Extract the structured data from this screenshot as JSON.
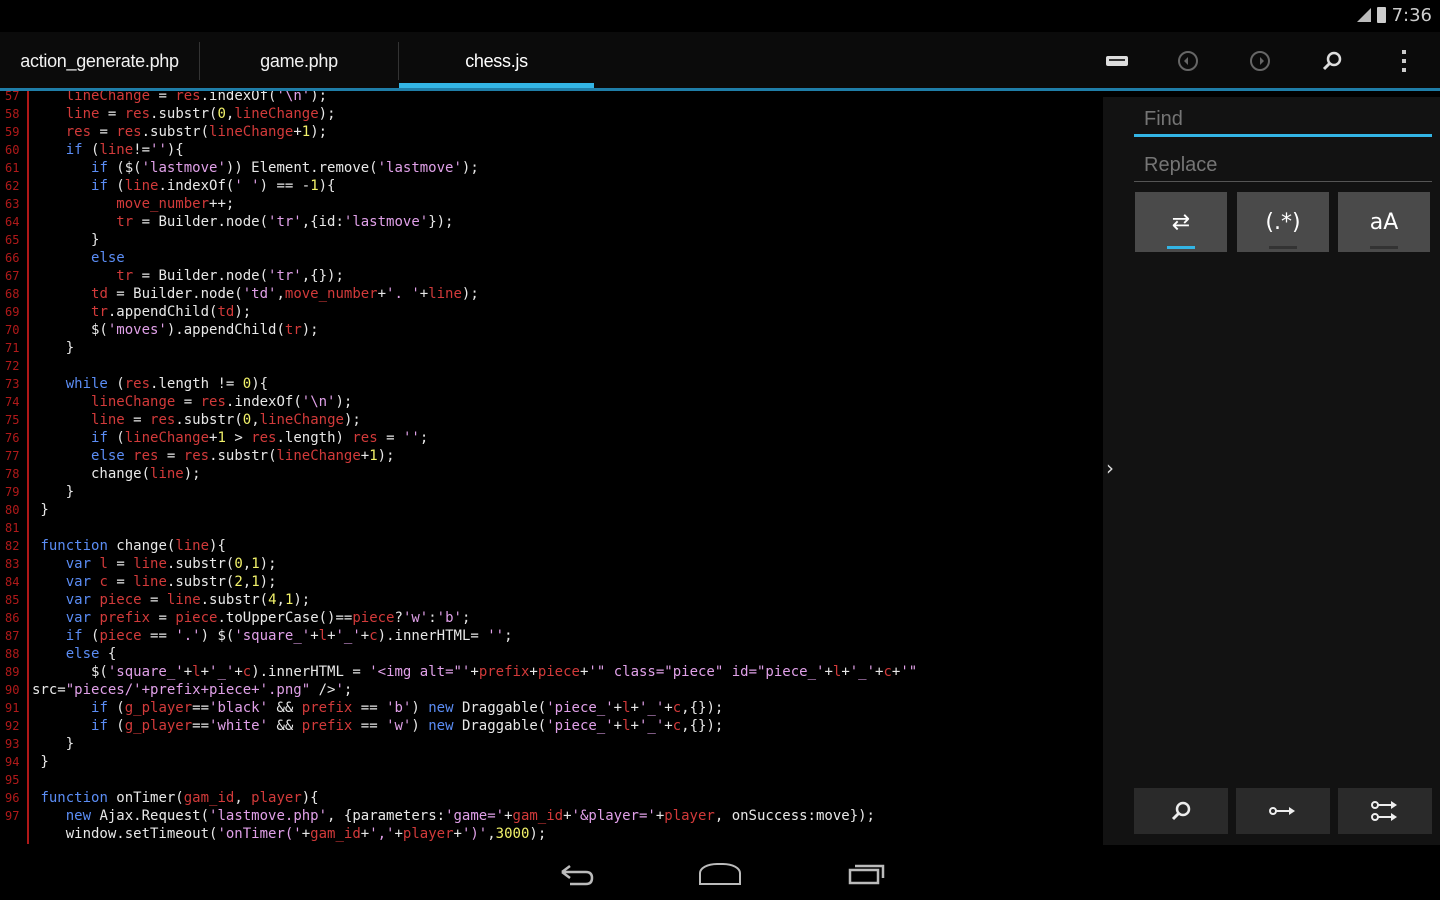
{
  "status_bar": {
    "time": "7:36",
    "icons": [
      "signal-icon",
      "battery-icon"
    ]
  },
  "tabs": [
    {
      "label": "action_generate.php",
      "active": false
    },
    {
      "label": "game.php",
      "active": false
    },
    {
      "label": "chess.js",
      "active": true
    }
  ],
  "action_icons": [
    "keyboard-icon",
    "undo-icon",
    "redo-icon",
    "search-icon",
    "overflow-menu-icon"
  ],
  "colors": {
    "accent": "#33b5e5",
    "line_number": "#b01a1a",
    "keyword": "#5b8df5",
    "string": "#e0a0e8",
    "number": "#f2f26a",
    "variable": "#d23a3a",
    "text": "#e8e8e8"
  },
  "code_lines": [
    {
      "n": "57",
      "text": "    lineChange = res.indexOf('\\n');"
    },
    {
      "n": "58",
      "text": "    line = res.substr(0,lineChange);"
    },
    {
      "n": "59",
      "text": "    res = res.substr(lineChange+1);"
    },
    {
      "n": "60",
      "text": "    if (line!=''){"
    },
    {
      "n": "61",
      "text": "       if ($('lastmove')) Element.remove('lastmove');"
    },
    {
      "n": "62",
      "text": "       if (line.indexOf(' ') == -1){"
    },
    {
      "n": "63",
      "text": "          move_number++;"
    },
    {
      "n": "64",
      "text": "          tr = Builder.node('tr',{id:'lastmove'});"
    },
    {
      "n": "65",
      "text": "       }"
    },
    {
      "n": "66",
      "text": "       else"
    },
    {
      "n": "67",
      "text": "          tr = Builder.node('tr',{});"
    },
    {
      "n": "68",
      "text": "       td = Builder.node('td',move_number+'. '+line);"
    },
    {
      "n": "69",
      "text": "       tr.appendChild(td);"
    },
    {
      "n": "70",
      "text": "       $('moves').appendChild(tr);"
    },
    {
      "n": "71",
      "text": "    }"
    },
    {
      "n": "72",
      "text": ""
    },
    {
      "n": "73",
      "text": "    while (res.length != 0){"
    },
    {
      "n": "74",
      "text": "       lineChange = res.indexOf('\\n');"
    },
    {
      "n": "75",
      "text": "       line = res.substr(0,lineChange);"
    },
    {
      "n": "76",
      "text": "       if (lineChange+1 > res.length) res = '';"
    },
    {
      "n": "77",
      "text": "       else res = res.substr(lineChange+1);"
    },
    {
      "n": "78",
      "text": "       change(line);"
    },
    {
      "n": "79",
      "text": "    }"
    },
    {
      "n": "80",
      "text": " }"
    },
    {
      "n": "81",
      "text": ""
    },
    {
      "n": "82",
      "text": " function change(line){"
    },
    {
      "n": "83",
      "text": "    var l = line.substr(0,1);"
    },
    {
      "n": "84",
      "text": "    var c = line.substr(2,1);"
    },
    {
      "n": "85",
      "text": "    var piece = line.substr(4,1);"
    },
    {
      "n": "86",
      "text": "    var prefix = piece.toUpperCase()==piece?'w':'b';"
    },
    {
      "n": "87",
      "text": "    if (piece == '.') $('square_'+l+'_'+c).innerHTML= '';"
    },
    {
      "n": "88",
      "text": "    else {"
    },
    {
      "n": "89",
      "text": "       $('square_'+l+'_'+c).innerHTML = '<img alt=\"'+prefix+piece+'\" class=\"piece\" id=\"piece_'+l+'_'+c+'\""
    },
    {
      "n": "90",
      "text": "src=\"pieces/'+prefix+piece+'.png\" />';"
    },
    {
      "n": "91",
      "text": "       if (g_player=='black' && prefix == 'b') new Draggable('piece_'+l+'_'+c,{});"
    },
    {
      "n": "92",
      "text": "       if (g_player=='white' && prefix == 'w') new Draggable('piece_'+l+'_'+c,{});"
    },
    {
      "n": "93",
      "text": "    }"
    },
    {
      "n": "94",
      "text": " }"
    },
    {
      "n": "95",
      "text": ""
    },
    {
      "n": "96",
      "text": " function onTimer(gam_id, player){"
    },
    {
      "n": "97",
      "text": "    new Ajax.Request('lastmove.php', {parameters:'game='+gam_id+'&player='+player, onSuccess:move});"
    },
    {
      "n": "",
      "text": "    window.setTimeout('onTimer('+gam_id+','+player+')',3000);"
    }
  ],
  "find_panel": {
    "find_placeholder": "Find",
    "replace_placeholder": "Replace",
    "toggles": [
      {
        "label": "⇄",
        "icon": "wrap-around-icon",
        "on": true
      },
      {
        "label": "(.*)",
        "icon": "regex-icon",
        "on": false
      },
      {
        "label": "aA",
        "icon": "match-case-icon",
        "on": false
      }
    ],
    "actions": [
      "find-next-icon",
      "replace-icon",
      "replace-all-icon"
    ]
  }
}
